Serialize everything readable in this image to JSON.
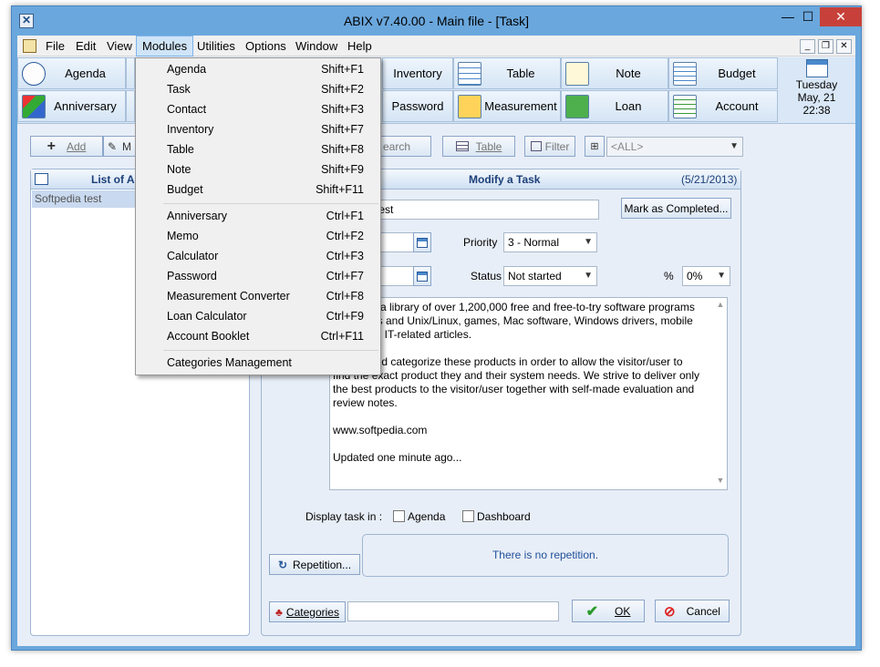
{
  "window": {
    "title": "ABIX v7.40.00  -  Main file - [Task]"
  },
  "caption": {
    "minimize": "—",
    "maximize": "☐",
    "close": "✕"
  },
  "menubar": {
    "items": [
      "File",
      "Edit",
      "View",
      "Modules",
      "Utilities",
      "Options",
      "Window",
      "Help"
    ]
  },
  "mdi": {
    "minimize": "_",
    "restore": "❐",
    "close": "✕"
  },
  "toolbar": {
    "row1": [
      "Agenda",
      "",
      "Inventory",
      "Table",
      "Note",
      "Budget"
    ],
    "row2": [
      "Anniversary",
      "",
      "Password",
      "Measurement",
      "Loan",
      "Account"
    ]
  },
  "datebox": {
    "day": "Tuesday",
    "date": "May, 21",
    "time": "22:38"
  },
  "actions": {
    "add": "Add",
    "modify": "M",
    "search": "earch",
    "table": "Table",
    "filter": "Filter",
    "category_select": "<ALL>"
  },
  "left_panel": {
    "title": "List of Ac",
    "rows": [
      "Softpedia test"
    ]
  },
  "right_panel": {
    "title": "Modify a Task",
    "date": "(5/21/2013)",
    "name_value": "test",
    "mark_completed": "Mark as Completed...",
    "priority_label": "Priority",
    "priority_value": "3 - Normal",
    "status_label": "Status",
    "status_value": "Not started",
    "percent_label": "%",
    "percent_value": "0%",
    "description": [
      "is a library of over 1,200,000 free and free-to-try software programs",
      "ws and Unix/Linux, games, Mac software, Windows drivers, mobile",
      "nd IT-related articles.",
      "",
      "and categorize these products in order to allow the visitor/user to",
      "find the exact product they and their system needs. We strive to deliver only",
      "the best products to the visitor/user together with self-made evaluation and",
      "review notes.",
      "",
      "www.softpedia.com",
      "",
      "Updated one minute ago..."
    ],
    "display_label": "Display task in :",
    "display_agenda": "Agenda",
    "display_dashboard": "Dashboard",
    "repetition_button": "Repetition...",
    "repetition_text": "There is no repetition.",
    "categories_button": "Categories",
    "ok": "OK",
    "cancel": "Cancel"
  },
  "modules_menu": {
    "group1": [
      {
        "label": "Agenda",
        "shortcut": "Shift+F1"
      },
      {
        "label": "Task",
        "shortcut": "Shift+F2"
      },
      {
        "label": "Contact",
        "shortcut": "Shift+F3"
      },
      {
        "label": "Inventory",
        "shortcut": "Shift+F7"
      },
      {
        "label": "Table",
        "shortcut": "Shift+F8"
      },
      {
        "label": "Note",
        "shortcut": "Shift+F9"
      },
      {
        "label": "Budget",
        "shortcut": "Shift+F11"
      }
    ],
    "group2": [
      {
        "label": "Anniversary",
        "shortcut": "Ctrl+F1"
      },
      {
        "label": "Memo",
        "shortcut": "Ctrl+F2"
      },
      {
        "label": "Calculator",
        "shortcut": "Ctrl+F3"
      },
      {
        "label": "Password",
        "shortcut": "Ctrl+F7"
      },
      {
        "label": "Measurement Converter",
        "shortcut": "Ctrl+F8"
      },
      {
        "label": "Loan Calculator",
        "shortcut": "Ctrl+F9"
      },
      {
        "label": "Account Booklet",
        "shortcut": "Ctrl+F11"
      }
    ],
    "group3": [
      {
        "label": "Categories Management",
        "shortcut": ""
      }
    ]
  },
  "colors": {
    "titlebar": "#6aa7dd",
    "close": "#c7413a",
    "header_text": "#1c3f78"
  }
}
